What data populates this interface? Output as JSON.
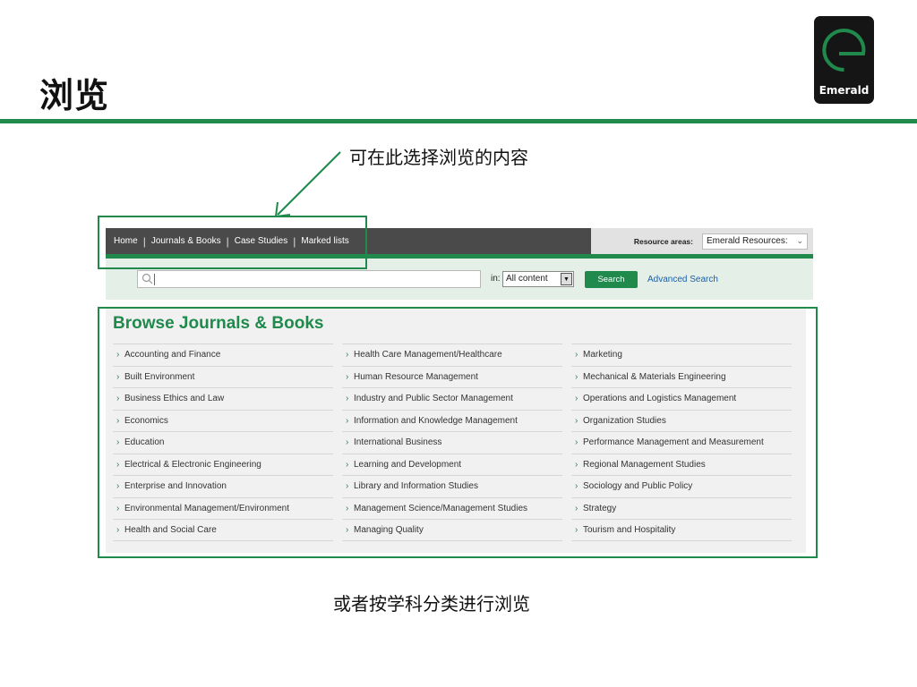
{
  "slide": {
    "title": "浏览",
    "callout_top": "可在此选择浏览的内容",
    "callout_bottom": "或者按学科分类进行浏览",
    "logo_text": "Emerald"
  },
  "nav": {
    "items": [
      "Home",
      "Journals & Books",
      "Case Studies",
      "Marked lists"
    ]
  },
  "resources": {
    "label": "Resource areas:",
    "selected": "Emerald Resources:"
  },
  "search": {
    "in_label": "in:",
    "scope_selected": "All content",
    "button_label": "Search",
    "advanced_label": "Advanced Search"
  },
  "browse": {
    "title": "Browse Journals & Books",
    "columns": [
      [
        "Accounting and Finance",
        "Built Environment",
        "Business Ethics and Law",
        "Economics",
        "Education",
        "Electrical & Electronic Engineering",
        "Enterprise and Innovation",
        "Environmental Management/Environment",
        "Health and Social Care"
      ],
      [
        "Health Care Management/Healthcare",
        "Human Resource Management",
        "Industry and Public Sector Management",
        "Information and Knowledge Management",
        "International Business",
        "Learning and Development",
        "Library and Information Studies",
        "Management Science/Management Studies",
        "Managing Quality"
      ],
      [
        "Marketing",
        "Mechanical & Materials Engineering",
        "Operations and Logistics Management",
        "Organization Studies",
        "Performance Management and Measurement",
        "Regional Management Studies",
        "Sociology and Public Policy",
        "Strategy",
        "Tourism and Hospitality"
      ]
    ]
  },
  "colors": {
    "accent_green": "#1f8a4c",
    "nav_bg": "#4a4a4a",
    "link_blue": "#1a5fa8"
  }
}
